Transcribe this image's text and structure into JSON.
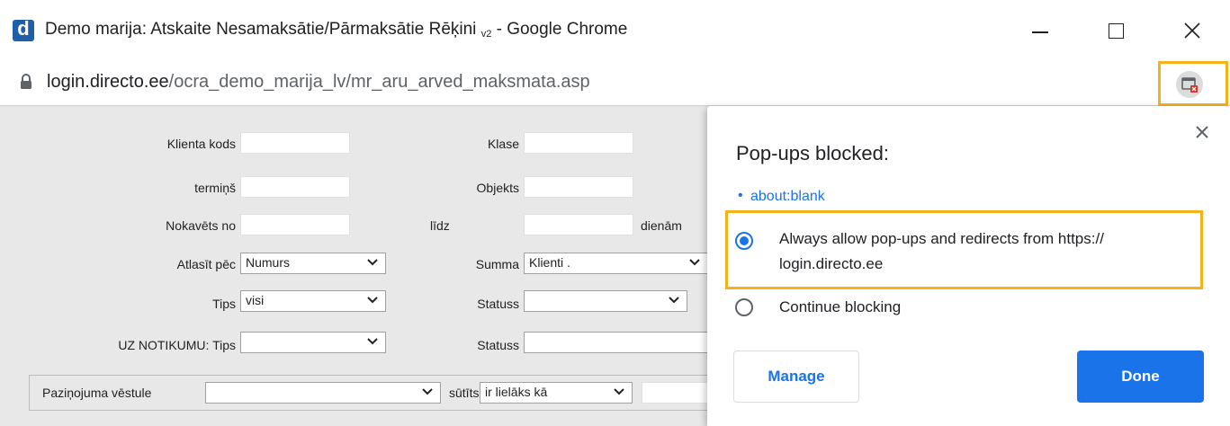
{
  "window": {
    "title_main": "Demo marija: Atskaite Nesamaksātie/Pārmaksātie Rēķini",
    "title_sub": "v2",
    "title_suffix": " - Google Chrome"
  },
  "address": {
    "host": "login.directo.ee",
    "path": "/ocra_demo_marija_lv/mr_aru_arved_maksmata.asp"
  },
  "form": {
    "klienta_kods": "Klienta kods",
    "klase": "Klase",
    "termins": "termiņš",
    "objekts": "Objekts",
    "nokavets_no": "Nokavēts no",
    "lidz": "līdz",
    "dienam": "dienām",
    "atlasit_pec": "Atlasīt pēc",
    "atlasit_pec_value": "Numurs",
    "summa": "Summa",
    "summa_value": "Klienti .",
    "tips": "Tips",
    "tips_value": "visi",
    "statuss": "Statuss",
    "statuss_value": "",
    "uz_notikumu_tips": "UZ NOTIKUMU: Tips",
    "uz_notikumu_tips_value": "",
    "statuss2": "Statuss",
    "pazinojuma_vestule": "Paziņojuma vēstule",
    "pazinojuma_value": "",
    "sutits": "sūtīts",
    "sutits_value": "ir lielāks kā"
  },
  "popup": {
    "title": "Pop-ups blocked:",
    "blocked_item": "about:blank",
    "option_allow_line1": "Always allow pop-ups and redirects from https://",
    "option_allow_line2": "login.directo.ee",
    "option_block": "Continue blocking",
    "manage_label": "Manage",
    "done_label": "Done"
  },
  "colors": {
    "accent": "#1a73e8",
    "highlight": "#f6b21b"
  }
}
